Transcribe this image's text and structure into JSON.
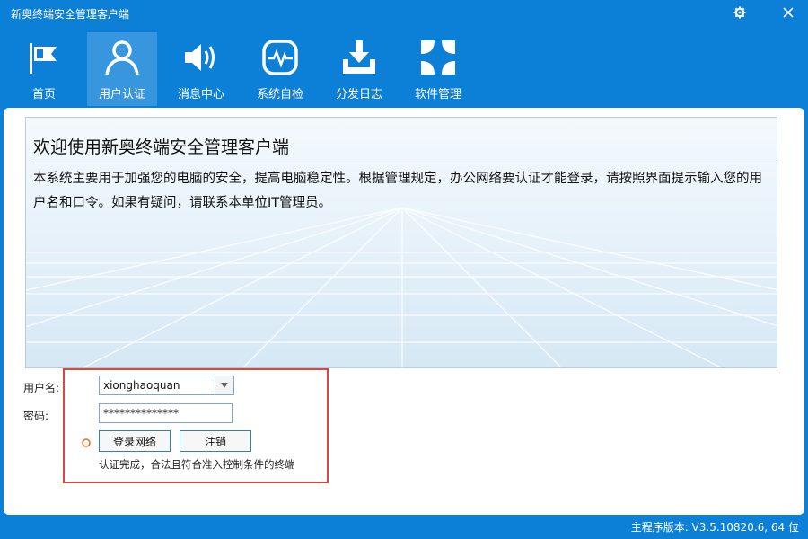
{
  "window": {
    "title": "新奥终端安全管理客户端",
    "settings_icon": "gear-icon",
    "close_icon": "close-icon"
  },
  "nav": [
    {
      "label": "首页",
      "icon": "flag-icon"
    },
    {
      "label": "用户认证",
      "icon": "user-icon",
      "active": true
    },
    {
      "label": "消息中心",
      "icon": "speaker-icon"
    },
    {
      "label": "系统自检",
      "icon": "pulse-monitor-icon"
    },
    {
      "label": "分发日志",
      "icon": "download-tray-icon"
    },
    {
      "label": "软件管理",
      "icon": "software-grid-icon"
    }
  ],
  "banner": {
    "title": "欢迎使用新奥终端安全管理客户端",
    "text": "本系统主要用于加强您的电脑的安全，提高电脑稳定性。根据管理规定，办公网络要认证才能登录，请按照界面提示输入您的用户名和口令。如果有疑问，请联系本单位IT管理员。"
  },
  "login": {
    "username_label": "用户名:",
    "username_value": "xionghaoquan",
    "password_label": "密码:",
    "password_value": "**************",
    "login_button": "登录网络",
    "logout_button": "注销",
    "status_text": "认证完成，合法且符合准入控制条件的终端"
  },
  "footer": {
    "version": "主程序版本: V3.5.10820.6, 64 位"
  },
  "colors": {
    "brand": "#0c7fd6",
    "highlight": "#d9473f"
  }
}
